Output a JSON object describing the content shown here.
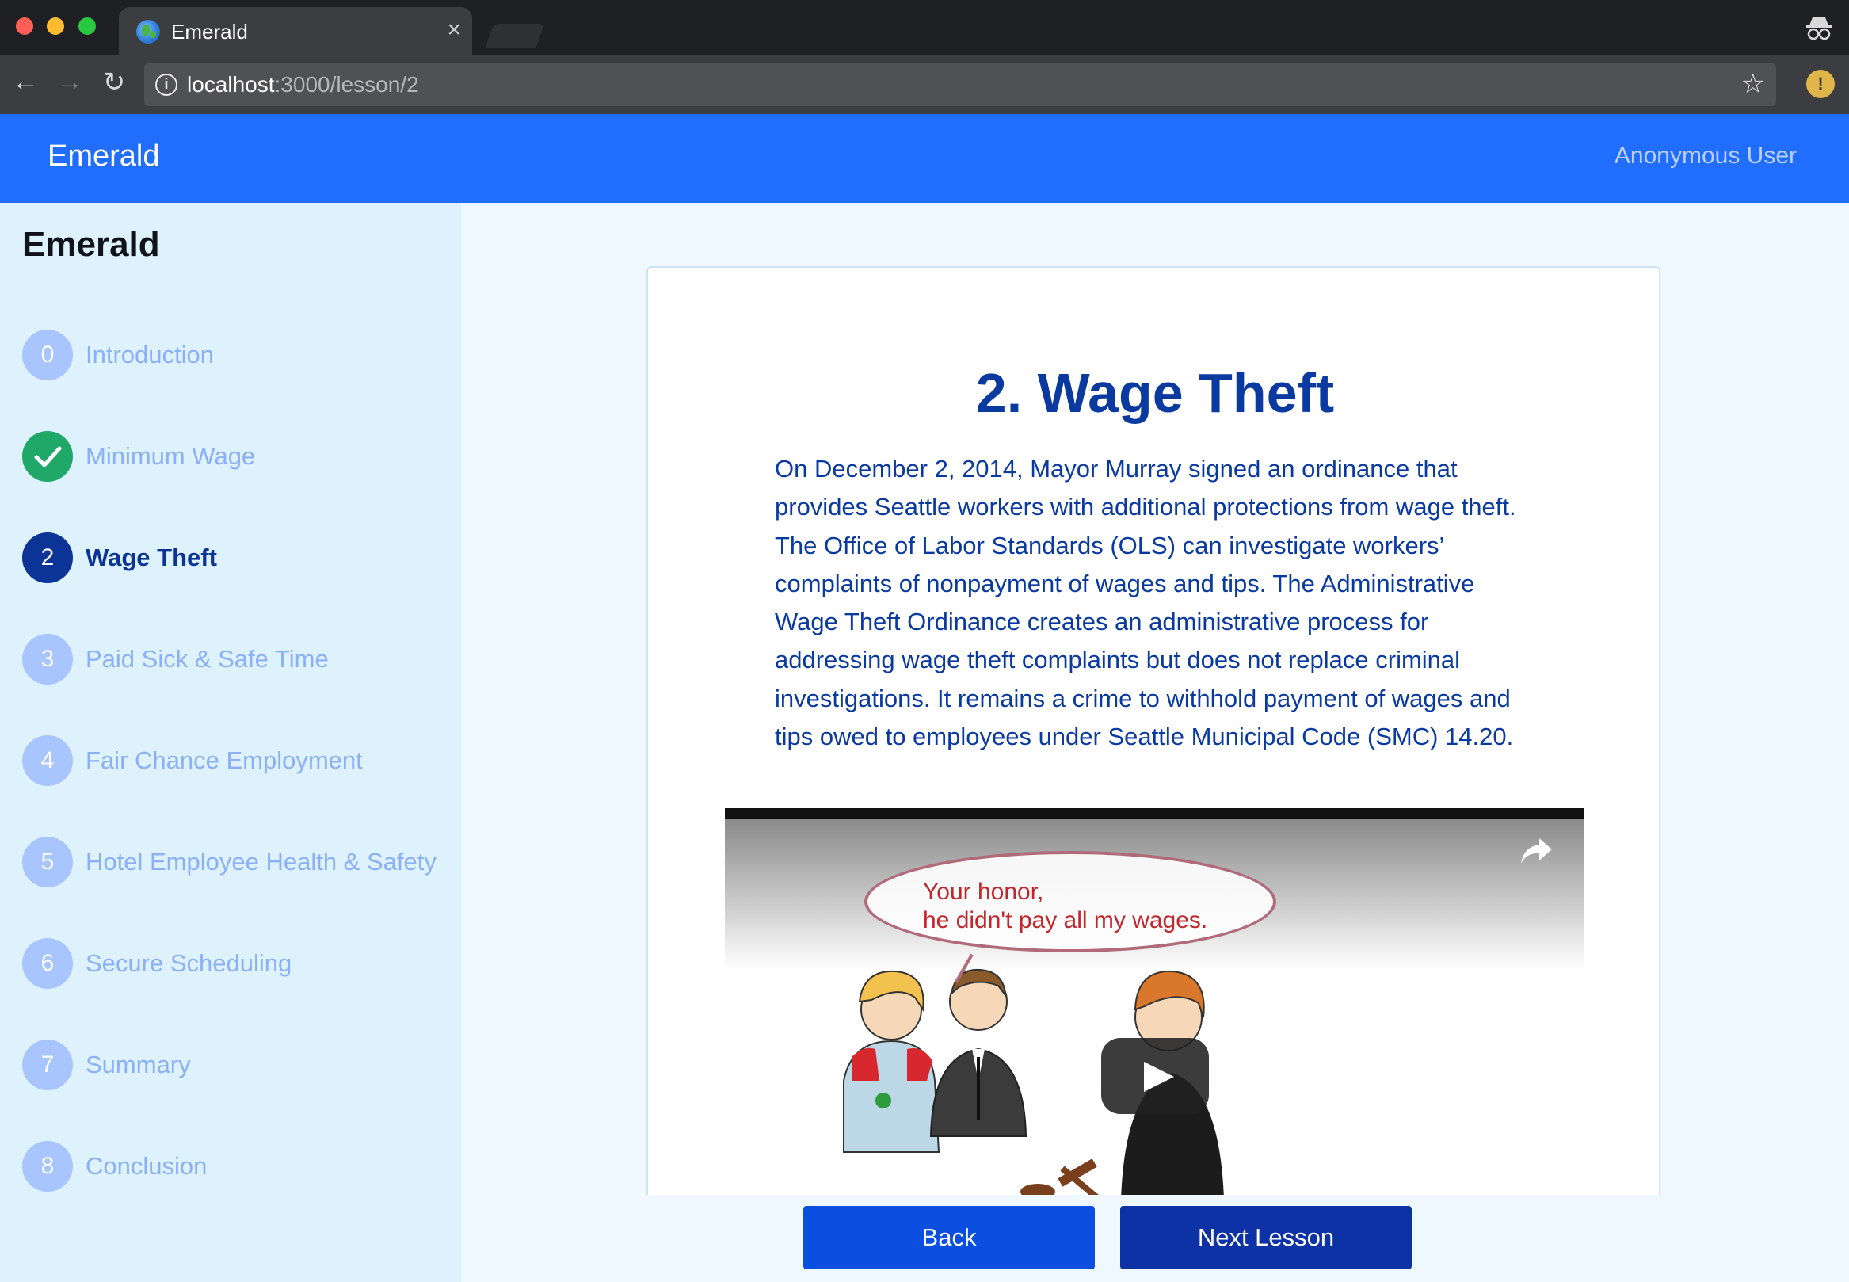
{
  "browser": {
    "tab_title": "Emerald",
    "tab_close": "×",
    "url_host": "localhost",
    "url_path": ":3000/lesson/2",
    "nav_back": "←",
    "nav_forward": "→",
    "nav_reload": "↻",
    "bookmark_star": "☆",
    "info_symbol": "i",
    "extension_symbol": "!",
    "icons": [
      "globe-favicon-icon",
      "close-icon",
      "back-arrow-icon",
      "forward-arrow-icon",
      "reload-icon",
      "info-icon",
      "star-icon",
      "extension-icon",
      "incognito-icon"
    ],
    "colors": {
      "tabbar": "#1f2023",
      "toolbar": "#3c3d40",
      "omnibox": "#505155"
    }
  },
  "header": {
    "brand": "Emerald",
    "user": "Anonymous User",
    "color": "#216dfd"
  },
  "sidebar": {
    "title": "Emerald",
    "steps": [
      {
        "num": "0",
        "label": "Introduction",
        "state": "upcoming"
      },
      {
        "num": "",
        "label": "Minimum Wage",
        "state": "done",
        "icon": "check-icon"
      },
      {
        "num": "2",
        "label": "Wage Theft",
        "state": "active"
      },
      {
        "num": "3",
        "label": "Paid Sick & Safe Time",
        "state": "upcoming"
      },
      {
        "num": "4",
        "label": "Fair Chance Employment",
        "state": "upcoming"
      },
      {
        "num": "5",
        "label": "Hotel Employee Health & Safety",
        "state": "upcoming"
      },
      {
        "num": "6",
        "label": "Secure Scheduling",
        "state": "upcoming"
      },
      {
        "num": "7",
        "label": "Summary",
        "state": "upcoming"
      },
      {
        "num": "8",
        "label": "Conclusion",
        "state": "upcoming"
      }
    ],
    "colors": {
      "upcoming": "#a9c5ff",
      "done": "#1fa868",
      "active": "#0c3396"
    }
  },
  "lesson": {
    "title": "2. Wage Theft",
    "body": "On December 2, 2014, Mayor Murray signed an ordinance that provides Seattle workers with additional protections from wage theft. The Office of Labor Standards (OLS) can investigate workers’ complaints of nonpayment of wages and tips. The Administrative Wage Theft Ordinance creates an administrative process for addressing wage theft complaints but does not replace criminal investigations. It remains a crime to withhold payment of wages and tips owed to employees under Seattle Municipal Code (SMC) 14.20.",
    "video": {
      "speech_line1": "Your honor,",
      "speech_line2": "he didn't pay all my wages.",
      "icons": [
        "share-icon",
        "play-icon"
      ]
    }
  },
  "actions": {
    "back": "Back",
    "next": "Next Lesson"
  }
}
